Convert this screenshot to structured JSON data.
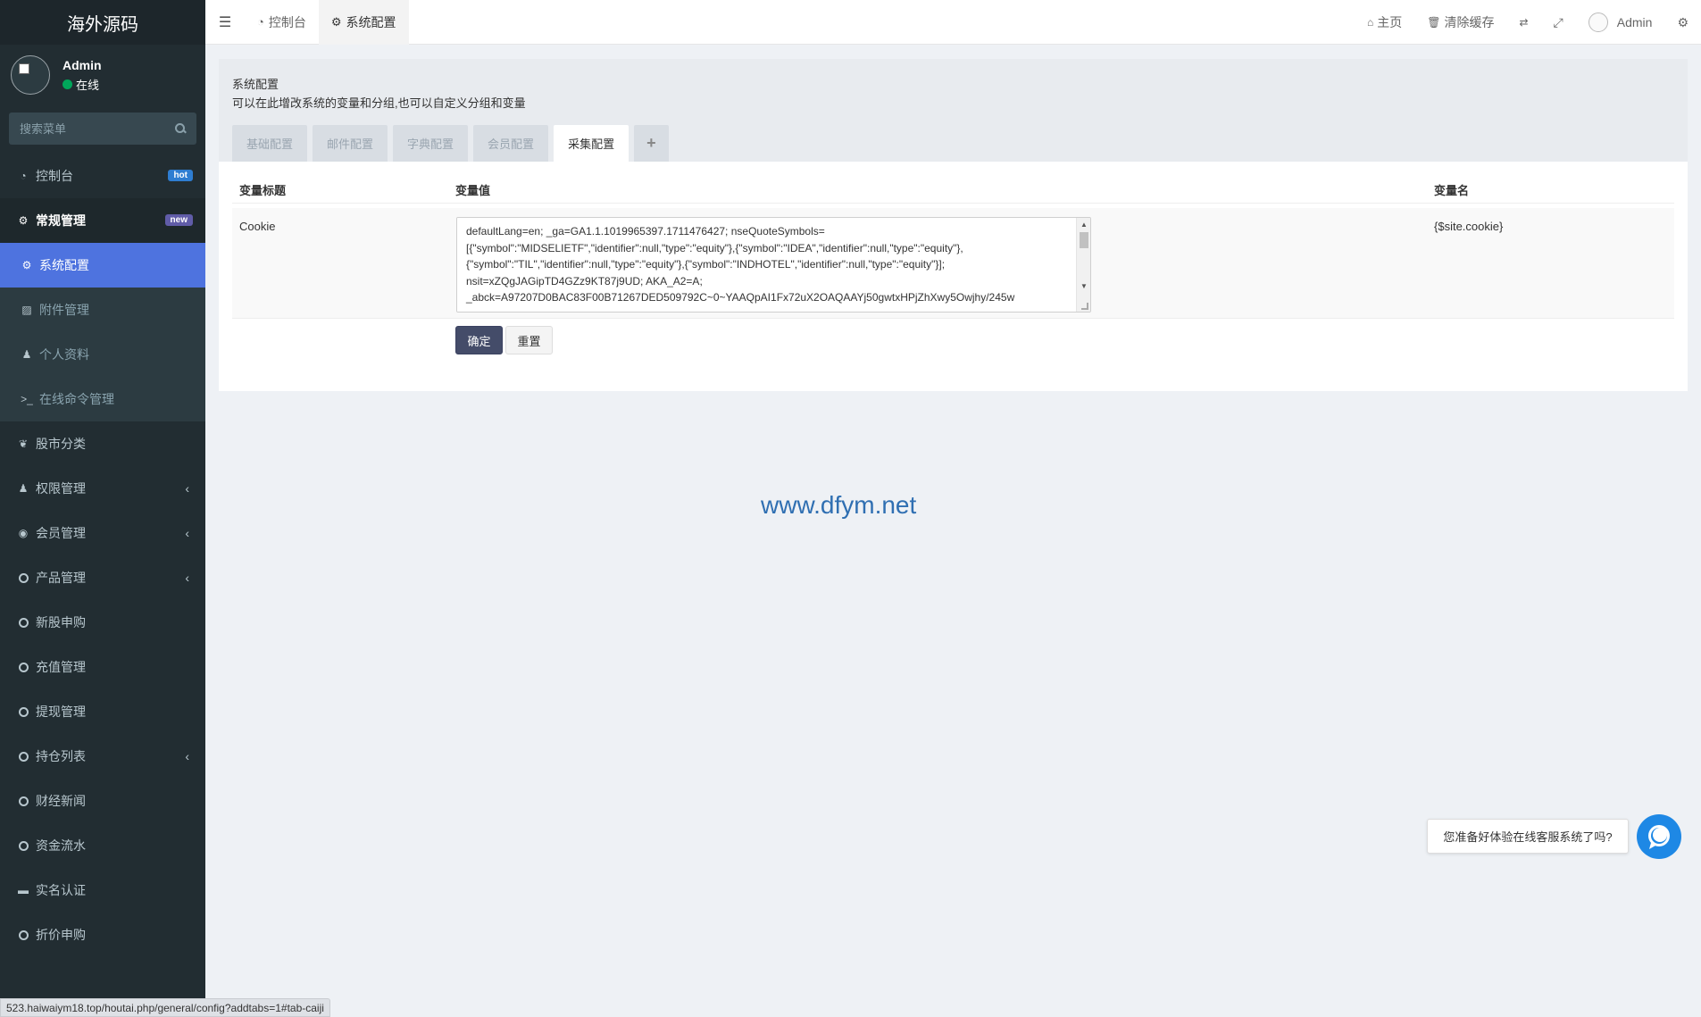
{
  "sidebar": {
    "logo": "海外源码",
    "user": {
      "name": "Admin",
      "status": "在线"
    },
    "search_placeholder": "搜索菜单",
    "items": [
      {
        "label": "控制台",
        "badge": "hot"
      },
      {
        "label": "常规管理",
        "badge": "new"
      },
      {
        "label": "股市分类"
      },
      {
        "label": "权限管理"
      },
      {
        "label": "会员管理"
      },
      {
        "label": "产品管理"
      },
      {
        "label": "新股申购"
      },
      {
        "label": "充值管理"
      },
      {
        "label": "提现管理"
      },
      {
        "label": "持仓列表"
      },
      {
        "label": "财经新闻"
      },
      {
        "label": "资金流水"
      },
      {
        "label": "实名认证"
      },
      {
        "label": "折价申购"
      }
    ],
    "submenu": [
      {
        "label": "系统配置"
      },
      {
        "label": "附件管理"
      },
      {
        "label": "个人资料"
      },
      {
        "label": "在线命令管理"
      }
    ]
  },
  "topbar": {
    "tabs": [
      {
        "label": "控制台"
      },
      {
        "label": "系统配置"
      }
    ],
    "right": {
      "home": "主页",
      "clear_cache": "清除缓存",
      "user": "Admin"
    }
  },
  "header": {
    "title": "系统配置",
    "desc": "可以在此增改系统的变量和分组,也可以自定义分组和变量",
    "tabs": [
      {
        "label": "基础配置"
      },
      {
        "label": "邮件配置"
      },
      {
        "label": "字典配置"
      },
      {
        "label": "会员配置"
      },
      {
        "label": "采集配置"
      }
    ],
    "add_tab": "+"
  },
  "table": {
    "headers": [
      "变量标题",
      "变量值",
      "变量名"
    ],
    "row": {
      "title": "Cookie",
      "value": "defaultLang=en; _ga=GA1.1.1019965397.1711476427; nseQuoteSymbols=[{\"symbol\":\"MIDSELIETF\",\"identifier\":null,\"type\":\"equity\"},{\"symbol\":\"IDEA\",\"identifier\":null,\"type\":\"equity\"},{\"symbol\":\"TIL\",\"identifier\":null,\"type\":\"equity\"},{\"symbol\":\"INDHOTEL\",\"identifier\":null,\"type\":\"equity\"}]; nsit=xZQgJAGipTD4GZz9KT87j9UD; AKA_A2=A; _abck=A97207D0BAC83F00B71267DED509792C~0~YAAQpAI1Fx72uX2OAQAAYj50gwtxHPjZhXwy5Owjhy/245w",
      "name": "{$site.cookie}"
    }
  },
  "buttons": {
    "ok": "确定",
    "reset": "重置"
  },
  "watermark": "www.dfym.net",
  "chat": {
    "prompt": "您准备好体验在线客服系统了吗?"
  },
  "status_url": "523.haiwaiym18.top/houtai.php/general/config?addtabs=1#tab-caiji"
}
